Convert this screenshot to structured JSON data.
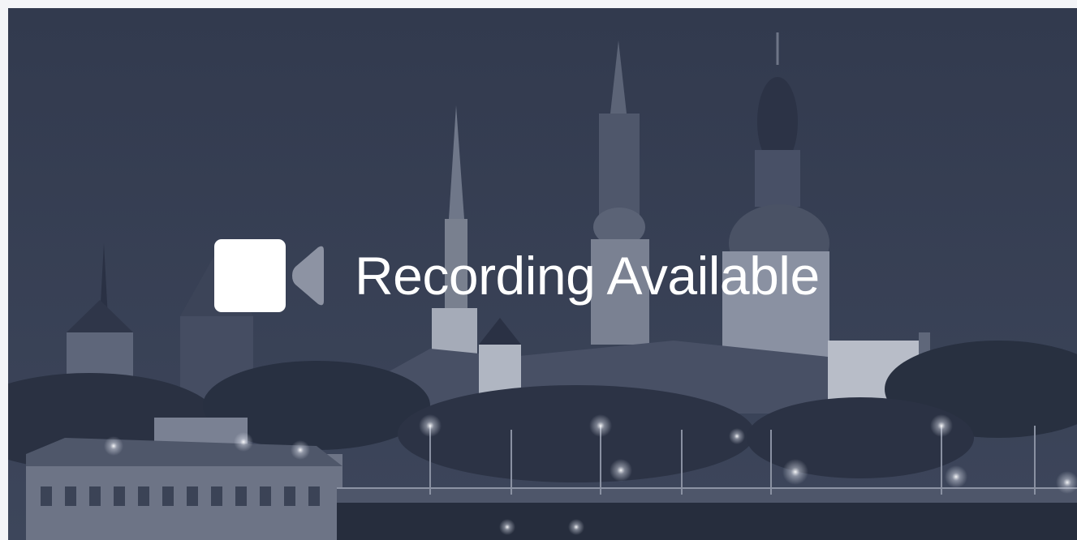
{
  "recording": {
    "label": "Recording Available",
    "icon": "video-camera-icon"
  },
  "colors": {
    "overlay_tint": "#3a4358",
    "text": "#ffffff",
    "icon_body": "#ffffff",
    "icon_lens": "#8d93a3"
  }
}
